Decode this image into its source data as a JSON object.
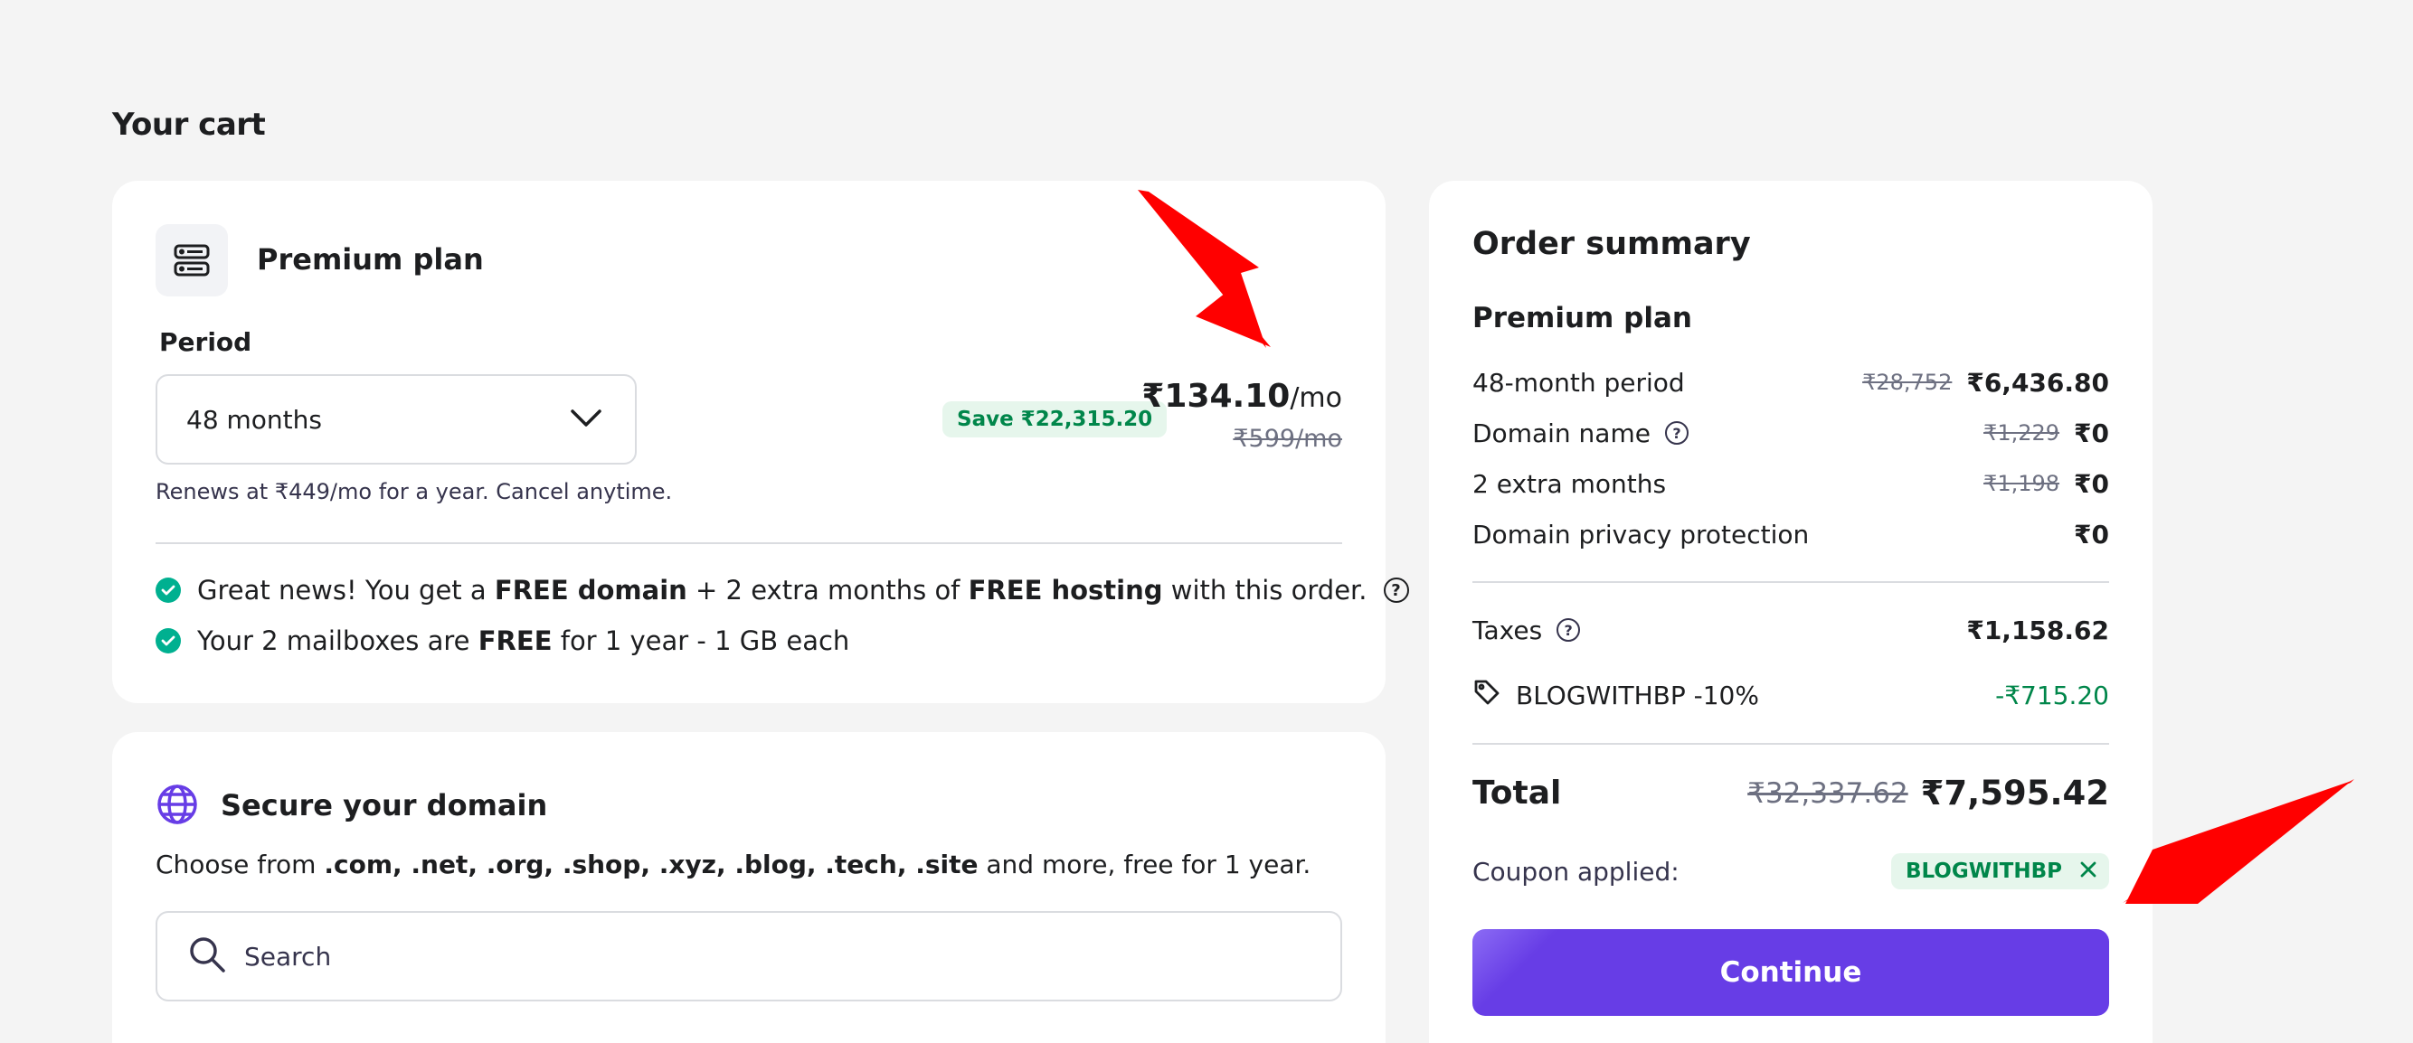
{
  "page": {
    "title": "Your cart"
  },
  "plan": {
    "name": "Premium plan",
    "period_label": "Period",
    "period_value": "48 months",
    "renew_text": "Renews at ₹449/mo for a year. Cancel anytime.",
    "save_badge": "Save ₹22,315.20",
    "price": "₹134.10",
    "price_unit": "/mo",
    "old_price": "₹599/mo",
    "benefits": [
      {
        "parts": [
          "Great news! You get a ",
          "FREE domain",
          " + 2 extra months of ",
          "FREE hosting",
          " with this order."
        ]
      },
      {
        "parts": [
          "Your 2 mailboxes are ",
          "FREE",
          " for 1 year - 1 GB each"
        ]
      }
    ]
  },
  "domain": {
    "title": "Secure your domain",
    "desc_prefix": "Choose from ",
    "desc_tlds": ".com, .net, .org, .shop, .xyz, .blog, .tech, .site",
    "desc_suffix": " and more, free for 1 year.",
    "search_placeholder": "Search"
  },
  "summary": {
    "title": "Order summary",
    "plan_name": "Premium plan",
    "rows": [
      {
        "label": "48-month period",
        "old": "₹28,752",
        "value": "₹6,436.80"
      },
      {
        "label": "Domain name",
        "old": "₹1,229",
        "value": "₹0"
      },
      {
        "label": "2 extra months",
        "old": "₹1,198",
        "value": "₹0"
      },
      {
        "label": "Domain privacy protection",
        "old": "",
        "value": "₹0"
      }
    ],
    "taxes_label": "Taxes",
    "taxes_value": "₹1,158.62",
    "discount_label": "BLOGWITHBP -10%",
    "discount_value": "-₹715.20",
    "total_label": "Total",
    "total_old": "₹32,337.62",
    "total_value": "₹7,595.42",
    "coupon_label": "Coupon applied:",
    "coupon_code": "BLOGWITHBP",
    "continue_label": "Continue"
  },
  "colors": {
    "accent": "#673de6",
    "success": "#00864a",
    "annotation_arrow": "#ff0000"
  }
}
